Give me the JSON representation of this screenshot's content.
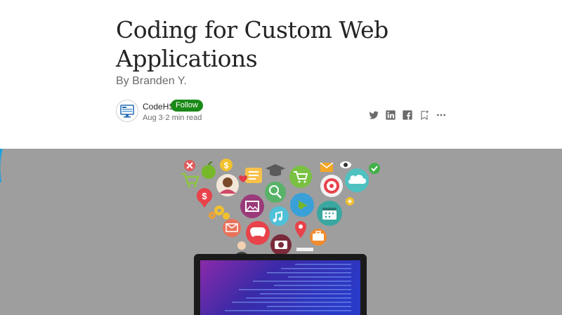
{
  "article": {
    "title": "Coding for Custom Web Applications",
    "subtitle": "By Branden Y."
  },
  "author": {
    "name": "CodeHS",
    "follow_label": "Follow",
    "date": "Aug 3",
    "separator": "·",
    "read_time": "2 min read"
  },
  "share": {
    "icons": [
      "twitter-icon",
      "linkedin-icon",
      "facebook-icon",
      "bookmark-add-icon",
      "more-icon"
    ]
  },
  "colors": {
    "follow": "#1a8917",
    "hero_background": "#9e9e9e",
    "title": "#242424",
    "muted": "#6b6b6b"
  },
  "hero": {
    "description_icons": [
      "cart-icon",
      "apple-icon",
      "dollar-icon",
      "user-avatar-icon",
      "heart-icon",
      "document-icon",
      "graduation-cap-icon",
      "cart-icon",
      "mail-icon",
      "eye-icon",
      "cloud-icon",
      "check-icon",
      "dollar-pin-icon",
      "gear-icon",
      "image-icon",
      "search-icon",
      "globe-icon",
      "target-icon",
      "plus-icon",
      "music-icon",
      "calendar-icon",
      "mail-icon",
      "gamepad-icon",
      "location-pin-icon",
      "briefcase-icon",
      "camera-icon"
    ]
  }
}
